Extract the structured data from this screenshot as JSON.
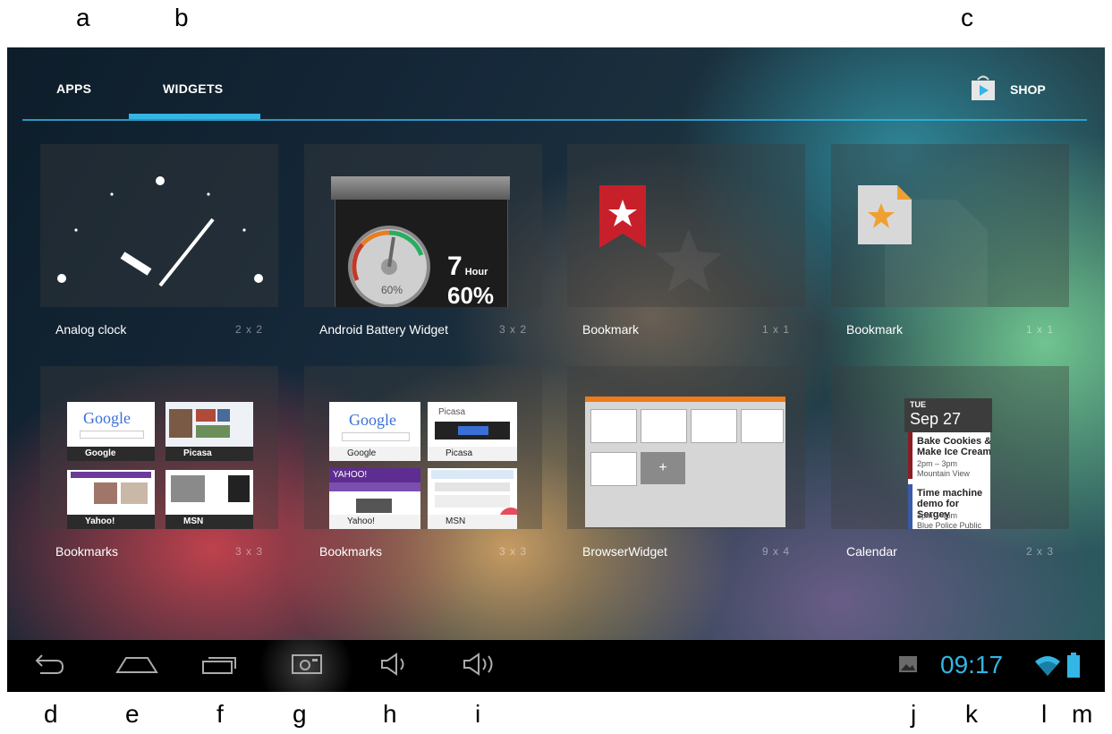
{
  "callouts": {
    "a": "a",
    "b": "b",
    "c": "c",
    "d": "d",
    "e": "e",
    "f": "f",
    "g": "g",
    "h": "h",
    "i": "i",
    "j": "j",
    "k": "k",
    "l": "l",
    "m": "m"
  },
  "tabs": {
    "apps": "APPS",
    "widgets": "WIDGETS",
    "shop": "SHOP"
  },
  "accent": "#33b5e5",
  "widgets": [
    {
      "name": "Analog clock",
      "size": "2 x 2"
    },
    {
      "name": "Android Battery Widget",
      "size": "3 x 2"
    },
    {
      "name": "Bookmark",
      "size": "1 x 1"
    },
    {
      "name": "Bookmark",
      "size": "1 x 1"
    },
    {
      "name": "Bookmarks",
      "size": "3 x 3"
    },
    {
      "name": "Bookmarks",
      "size": "3 x 3"
    },
    {
      "name": "BrowserWidget",
      "size": "9 x 4"
    },
    {
      "name": "Calendar",
      "size": "2 x 3"
    }
  ],
  "battery_widget": {
    "hours": "7",
    "hour_unit": "Hour",
    "percent": "60%",
    "gauge_percent": "60%"
  },
  "bookmarks_small": {
    "google": "Google",
    "picasa": "Picasa",
    "yahoo": "Yahoo!",
    "msn": "MSN"
  },
  "bookmarks_large": {
    "google": "Google",
    "picasa": "Picasa",
    "yahoo": "Yahoo!",
    "msn": "MSN",
    "picasa_logo": "Picasa",
    "yahoo_logo": "YAHOO!"
  },
  "calendar_widget": {
    "day": "TUE",
    "date": "Sep 27",
    "events": [
      {
        "title": "Bake Cookies & Make Ice Cream",
        "time": "2pm – 3pm",
        "location": "Mountain View"
      },
      {
        "title": "Time machine demo for Sergey",
        "time": "3pm – 4pm",
        "location": "Blue Police Public"
      }
    ]
  },
  "status": {
    "time": "09:17"
  },
  "icons": {
    "back": "back-icon",
    "home": "home-icon",
    "recents": "recent-apps-icon",
    "screenshot": "screenshot-icon",
    "volume_down": "volume-down-icon",
    "volume_up": "volume-up-icon",
    "gallery": "gallery-notification-icon",
    "wifi": "wifi-icon",
    "battery": "battery-icon",
    "shop": "play-store-icon"
  }
}
